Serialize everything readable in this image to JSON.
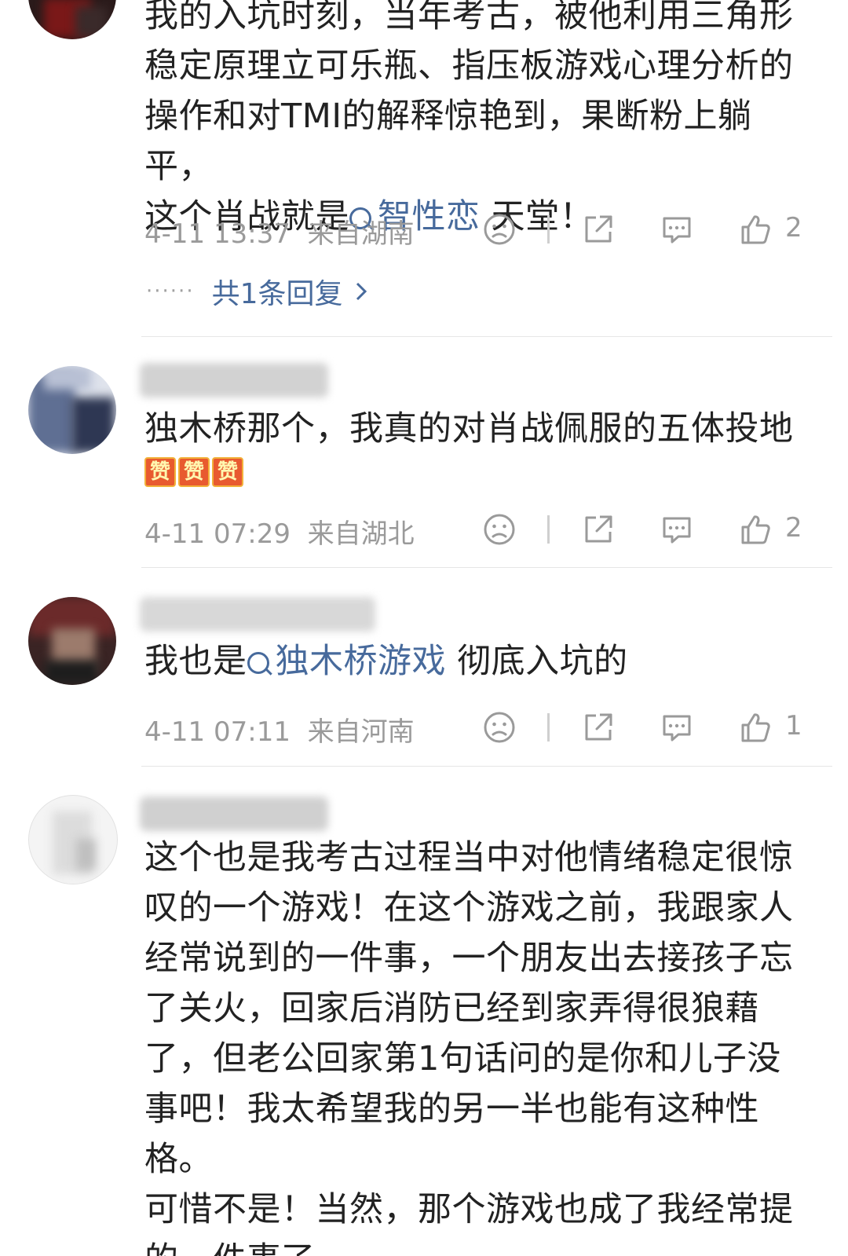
{
  "comments": [
    {
      "lines": [
        "我的入坑时刻，当年考古，被他利用三角形",
        "稳定原理立可乐瓶、指压板游戏心理分析的",
        "操作和对TMI的解释惊艳到，果断粉上躺平，"
      ],
      "line4_before": "这个肖战就是",
      "line4_topic": "智性恋",
      "line4_after": " 天堂！",
      "time": "4-11 13:37",
      "location": "来自湖南",
      "likes": "2",
      "replies_label": "共1条回复"
    },
    {
      "line1": "独木桥那个，我真的对肖战佩服的五体投地",
      "emoji": [
        "赞",
        "赞",
        "赞"
      ],
      "time": "4-11 07:29",
      "location": "来自湖北",
      "likes": "2"
    },
    {
      "before": "我也是",
      "topic": "独木桥游戏",
      "after": " 彻底入坑的",
      "time": "4-11 07:11",
      "location": "来自河南",
      "likes": "1"
    },
    {
      "lines": [
        "这个也是我考古过程当中对他情绪稳定很惊",
        "叹的一个游戏！在这个游戏之前，我跟家人",
        "经常说到的一件事，一个朋友出去接孩子忘",
        "了关火，回家后消防已经到家弄得很狼藉",
        "了，但老公回家第1句话问的是你和儿子没",
        "事吧！我太希望我的另一半也能有这种性格。",
        "可惜不是！当然，那个游戏也成了我经常提",
        "的一件事了。"
      ]
    }
  ],
  "icons": {
    "dislike": "sad-face-icon",
    "share": "share-icon",
    "comment": "comment-bubble-icon",
    "like": "thumbs-up-icon"
  },
  "colors": {
    "topic_link": "#476a9c",
    "meta_text": "#9a9a9a",
    "body_text": "#222222"
  }
}
